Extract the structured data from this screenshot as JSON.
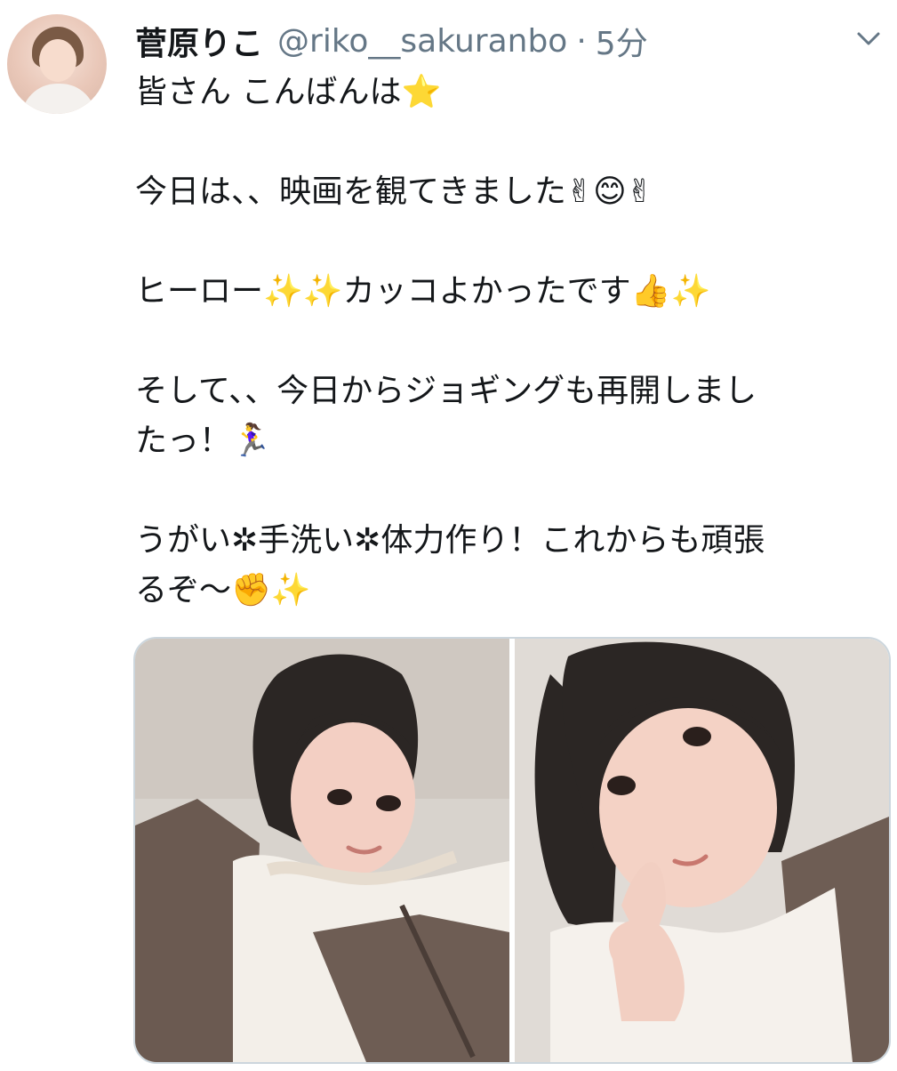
{
  "tweet": {
    "display_name": "菅原りこ",
    "handle": "@riko__sakuranbo",
    "separator": "·",
    "time": "5分",
    "lines": [
      "皆さん こんばんは⭐",
      "",
      "今日は、、映画を観てきました✌😊✌",
      "",
      "ヒーロー✨✨カッコよかったです👍✨",
      "",
      "そして、、今日からジョギングも再開しまし",
      "たっ！🏃‍♀️",
      "",
      "うがい✲手洗い✲体力作り！これからも頑張",
      "るぞ〜✊✨"
    ]
  },
  "media": {
    "count": 2
  },
  "icons": {
    "more": "chevron-down-icon",
    "avatar": "avatar"
  },
  "colors": {
    "text": "#14171a",
    "secondary": "#657786",
    "border": "#ccd6dd"
  }
}
